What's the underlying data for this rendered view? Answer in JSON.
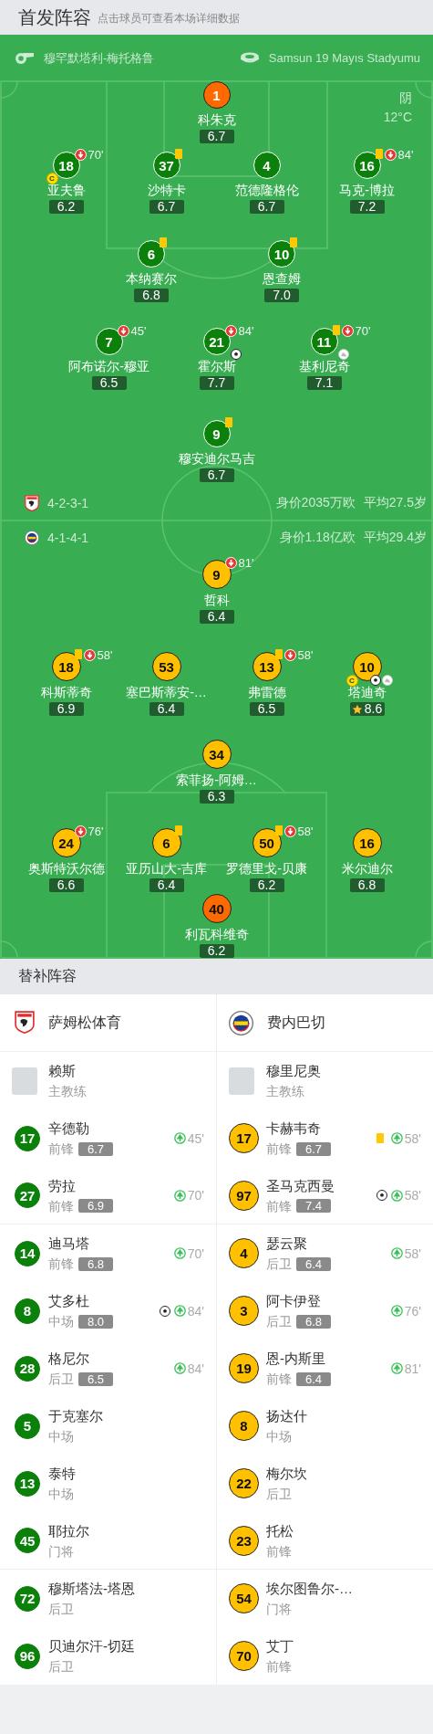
{
  "header": {
    "title": "首发阵容",
    "hint": "点击球员可查看本场详细数据"
  },
  "match": {
    "referee": "穆罕默塔利-梅托格鲁",
    "stadium": "Samsun 19 Mayıs Stadyumu",
    "weather": "阴",
    "temperature": "12°C"
  },
  "teams": [
    {
      "color": "#0b800b",
      "formation": "4-2-3-1",
      "market_value": "身价2035万欧",
      "average_age": "平均27.5岁",
      "captain_badge": "C",
      "rows": [
        {
          "players": [
            {
              "number": "1",
              "name": "科朱克",
              "rating": "6.7",
              "kind": "goalkeeper",
              "yellow_card": false,
              "captain": false,
              "goal": false,
              "assist": false,
              "best": false
            }
          ]
        },
        {
          "players": [
            {
              "number": "18",
              "name": "亚夫鲁",
              "rating": "6.2",
              "kind": "outfield",
              "yellow_card": false,
              "captain": true,
              "goal": false,
              "assist": false,
              "best": false,
              "subbed_off": "70'"
            },
            {
              "number": "37",
              "name": "沙特卡",
              "rating": "6.7",
              "kind": "outfield",
              "yellow_card": true,
              "captain": false,
              "goal": false,
              "assist": false,
              "best": false
            },
            {
              "number": "4",
              "name": "范德隆格伦",
              "rating": "6.7",
              "kind": "outfield",
              "yellow_card": false,
              "captain": false,
              "goal": false,
              "assist": false,
              "best": false
            },
            {
              "number": "16",
              "name": "马克-博拉",
              "rating": "7.2",
              "kind": "outfield",
              "yellow_card": true,
              "captain": false,
              "goal": false,
              "assist": false,
              "best": false,
              "subbed_off": "84'"
            }
          ]
        },
        {
          "players": [
            {
              "number": "6",
              "name": "本纳赛尔",
              "rating": "6.8",
              "kind": "outfield",
              "yellow_card": true,
              "captain": false,
              "goal": false,
              "assist": false,
              "best": false
            },
            {
              "number": "10",
              "name": "恩查姆",
              "rating": "7.0",
              "kind": "outfield",
              "yellow_card": true,
              "captain": false,
              "goal": false,
              "assist": false,
              "best": false
            }
          ]
        },
        {
          "players": [
            {
              "number": "7",
              "name": "阿布诺尔-穆亚",
              "rating": "6.5",
              "kind": "outfield",
              "yellow_card": false,
              "captain": false,
              "goal": false,
              "assist": false,
              "best": false,
              "subbed_off": "45'"
            },
            {
              "number": "21",
              "name": "霍尔斯",
              "rating": "7.7",
              "kind": "outfield",
              "yellow_card": false,
              "captain": false,
              "goal": true,
              "assist": false,
              "best": false,
              "subbed_off": "84'"
            },
            {
              "number": "11",
              "name": "基利尼奇",
              "rating": "7.1",
              "kind": "outfield",
              "yellow_card": true,
              "captain": false,
              "goal": false,
              "assist": true,
              "best": false,
              "subbed_off": "70'"
            }
          ]
        },
        {
          "players": [
            {
              "number": "9",
              "name": "穆安迪尔马吉",
              "rating": "6.7",
              "kind": "outfield",
              "yellow_card": true,
              "captain": false,
              "goal": false,
              "assist": false,
              "best": false
            }
          ]
        }
      ]
    },
    {
      "color": "#ffc000",
      "formation": "4-1-4-1",
      "market_value": "身价1.18亿欧",
      "average_age": "平均29.4岁",
      "captain_badge": "C",
      "rows": [
        {
          "players": [
            {
              "number": "9",
              "name": "哲科",
              "rating": "6.4",
              "kind": "outfield",
              "yellow_card": false,
              "captain": false,
              "goal": false,
              "assist": false,
              "best": false,
              "subbed_off": "81'"
            }
          ]
        },
        {
          "players": [
            {
              "number": "18",
              "name": "科斯蒂奇",
              "rating": "6.9",
              "kind": "outfield",
              "yellow_card": true,
              "captain": false,
              "goal": false,
              "assist": false,
              "best": false,
              "subbed_off": "58'"
            },
            {
              "number": "53",
              "name": "塞巴斯蒂安-…",
              "rating": "6.4",
              "kind": "outfield",
              "yellow_card": false,
              "captain": false,
              "goal": false,
              "assist": false,
              "best": false
            },
            {
              "number": "13",
              "name": "弗雷德",
              "rating": "6.5",
              "kind": "outfield",
              "yellow_card": true,
              "captain": false,
              "goal": false,
              "assist": false,
              "best": false,
              "subbed_off": "58'"
            },
            {
              "number": "10",
              "name": "塔迪奇",
              "rating": "8.6",
              "kind": "outfield",
              "yellow_card": false,
              "captain": true,
              "goal": true,
              "assist": true,
              "best": true
            }
          ]
        },
        {
          "players": [
            {
              "number": "34",
              "name": "索菲扬-阿姆…",
              "rating": "6.3",
              "kind": "outfield",
              "yellow_card": false,
              "captain": false,
              "goal": false,
              "assist": false,
              "best": false
            }
          ]
        },
        {
          "players": [
            {
              "number": "24",
              "name": "奥斯特沃尔德",
              "rating": "6.6",
              "kind": "outfield",
              "yellow_card": false,
              "captain": false,
              "goal": false,
              "assist": false,
              "best": false,
              "subbed_off": "76'"
            },
            {
              "number": "6",
              "name": "亚历山大-吉库",
              "rating": "6.4",
              "kind": "outfield",
              "yellow_card": true,
              "captain": false,
              "goal": false,
              "assist": false,
              "best": false
            },
            {
              "number": "50",
              "name": "罗德里戈-贝康",
              "rating": "6.2",
              "kind": "outfield",
              "yellow_card": true,
              "captain": false,
              "goal": false,
              "assist": false,
              "best": false,
              "subbed_off": "58'"
            },
            {
              "number": "16",
              "name": "米尔迪尔",
              "rating": "6.8",
              "kind": "outfield",
              "yellow_card": false,
              "captain": false,
              "goal": false,
              "assist": false,
              "best": false
            }
          ]
        },
        {
          "players": [
            {
              "number": "40",
              "name": "利瓦科维奇",
              "rating": "6.2",
              "kind": "goalkeeper",
              "yellow_card": false,
              "captain": false,
              "goal": false,
              "assist": false,
              "best": false
            }
          ]
        }
      ]
    }
  ],
  "substitutes": {
    "title": "替补阵容",
    "teams": [
      {
        "name": "萨姆松体育",
        "coach": {
          "name": "赖斯",
          "role": "主教练"
        },
        "players": [
          {
            "number": "17",
            "name": "辛德勒",
            "position": "前锋",
            "rating": "6.7",
            "subbed_on": "45'",
            "yellow_card": false,
            "goal": false
          },
          {
            "number": "27",
            "name": "劳拉",
            "position": "前锋",
            "rating": "6.9",
            "subbed_on": "70'",
            "yellow_card": false,
            "goal": false
          },
          {
            "number": "14",
            "name": "迪马塔",
            "position": "前锋",
            "rating": "6.8",
            "subbed_on": "70'",
            "yellow_card": false,
            "goal": false
          },
          {
            "number": "8",
            "name": "艾多杜",
            "position": "中场",
            "rating": "8.0",
            "subbed_on": "84'",
            "yellow_card": false,
            "goal": true
          },
          {
            "number": "28",
            "name": "格尼尔",
            "position": "后卫",
            "rating": "6.5",
            "subbed_on": "84'",
            "yellow_card": false,
            "goal": false
          },
          {
            "number": "5",
            "name": "于克塞尔",
            "position": "中场",
            "yellow_card": false,
            "goal": false
          },
          {
            "number": "13",
            "name": "泰特",
            "position": "中场",
            "yellow_card": false,
            "goal": false
          },
          {
            "number": "45",
            "name": "耶拉尔",
            "position": "门将",
            "yellow_card": false,
            "goal": false
          },
          {
            "number": "72",
            "name": "穆斯塔法-塔恩",
            "position": "后卫",
            "yellow_card": false,
            "goal": false
          },
          {
            "number": "96",
            "name": "贝迪尔汗-切廷",
            "position": "后卫",
            "yellow_card": false,
            "goal": false
          }
        ]
      },
      {
        "name": "费内巴切",
        "coach": {
          "name": "穆里尼奥",
          "role": "主教练"
        },
        "players": [
          {
            "number": "17",
            "name": "卡赫韦奇",
            "position": "前锋",
            "rating": "6.7",
            "subbed_on": "58'",
            "yellow_card": true,
            "goal": false
          },
          {
            "number": "97",
            "name": "圣马克西曼",
            "position": "前锋",
            "rating": "7.4",
            "subbed_on": "58'",
            "yellow_card": false,
            "goal": true
          },
          {
            "number": "4",
            "name": "瑟云聚",
            "position": "后卫",
            "rating": "6.4",
            "subbed_on": "58'",
            "yellow_card": false,
            "goal": false
          },
          {
            "number": "3",
            "name": "阿卡伊登",
            "position": "后卫",
            "rating": "6.8",
            "subbed_on": "76'",
            "yellow_card": false,
            "goal": false
          },
          {
            "number": "19",
            "name": "恩-内斯里",
            "position": "前锋",
            "rating": "6.4",
            "subbed_on": "81'",
            "yellow_card": false,
            "goal": false
          },
          {
            "number": "8",
            "name": "扬达什",
            "position": "中场",
            "yellow_card": false,
            "goal": false
          },
          {
            "number": "22",
            "name": "梅尔坎",
            "position": "后卫",
            "yellow_card": false,
            "goal": false
          },
          {
            "number": "23",
            "name": "托松",
            "position": "前锋",
            "yellow_card": false,
            "goal": false
          },
          {
            "number": "54",
            "name": "埃尔图鲁尔-…",
            "position": "门将",
            "yellow_card": false,
            "goal": false
          },
          {
            "number": "70",
            "name": "艾丁",
            "position": "前锋",
            "yellow_card": false,
            "goal": false
          }
        ]
      }
    ]
  }
}
